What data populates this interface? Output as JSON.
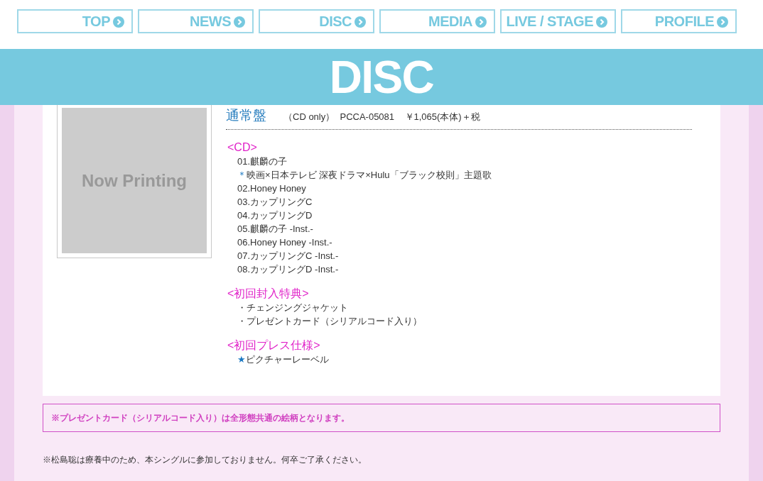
{
  "nav": [
    {
      "label": "TOP"
    },
    {
      "label": "NEWS"
    },
    {
      "label": "DISC"
    },
    {
      "label": "MEDIA"
    },
    {
      "label": "LIVE / STAGE"
    },
    {
      "label": "PROFILE"
    }
  ],
  "banner": {
    "title": "DISC"
  },
  "cover": {
    "text": "Now Printing"
  },
  "edition": {
    "title": "通常盤",
    "format": "（CD only）",
    "code": "PCCA-05081",
    "price": "￥1,065(本体)＋税"
  },
  "sections": [
    {
      "heading": "<CD>",
      "items": [
        {
          "text": "01.麒麟の子"
        },
        {
          "bullet": "＊",
          "text": "映画×日本テレビ 深夜ドラマ×Hulu「ブラック校則」主題歌"
        },
        {
          "text": "02.Honey Honey"
        },
        {
          "text": "03.カップリングC"
        },
        {
          "text": "04.カップリングD"
        },
        {
          "text": "05.麒麟の子 -Inst.-"
        },
        {
          "text": "06.Honey Honey -Inst.-"
        },
        {
          "text": "07.カップリングC -Inst.-"
        },
        {
          "text": "08.カップリングD -Inst.-"
        }
      ]
    },
    {
      "heading": "<初回封入特典>",
      "items": [
        {
          "text": "・チェンジングジャケット"
        },
        {
          "text": "・プレゼントカード（シリアルコード入り）"
        }
      ]
    },
    {
      "heading": "<初回プレス仕様>",
      "items": [
        {
          "bullet": "★",
          "text": "ピクチャーレーベル"
        }
      ]
    }
  ],
  "notice": "※プレゼントカード（シリアルコード入り）は全形態共通の絵柄となります。",
  "footnote": "※松島聡は療養中のため、本シングルに参加しておりません。何卒ご了承ください。"
}
